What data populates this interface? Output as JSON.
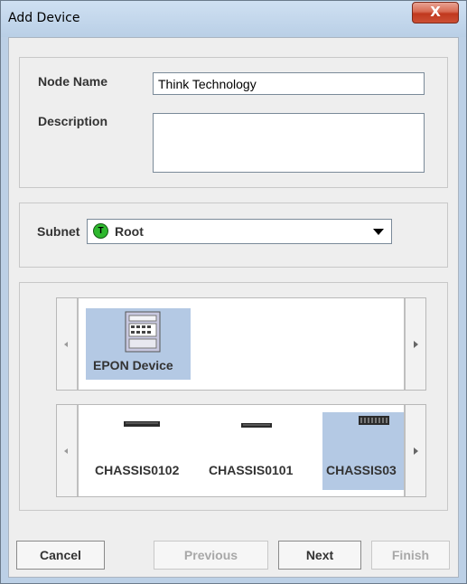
{
  "window": {
    "title": "Add Device",
    "close_glyph": "X"
  },
  "form": {
    "node_name_label": "Node Name",
    "node_name_value": "Think Technology",
    "description_label": "Description",
    "description_value": ""
  },
  "subnet": {
    "label": "Subnet",
    "selected": "Root",
    "icon": "T"
  },
  "device_types": [
    {
      "label": "EPON Device",
      "selected": true
    }
  ],
  "chassis": [
    {
      "label": "CHASSIS0102",
      "selected": false
    },
    {
      "label": "CHASSIS0101",
      "selected": false
    },
    {
      "label": "CHASSIS03",
      "selected": true
    }
  ],
  "buttons": {
    "cancel": "Cancel",
    "previous": "Previous",
    "next": "Next",
    "finish": "Finish"
  },
  "colors": {
    "selection": "#b4c9e4",
    "title_bar": "#bcd0e6",
    "close": "#c84a31",
    "subnet_icon": "#2eb82e"
  }
}
